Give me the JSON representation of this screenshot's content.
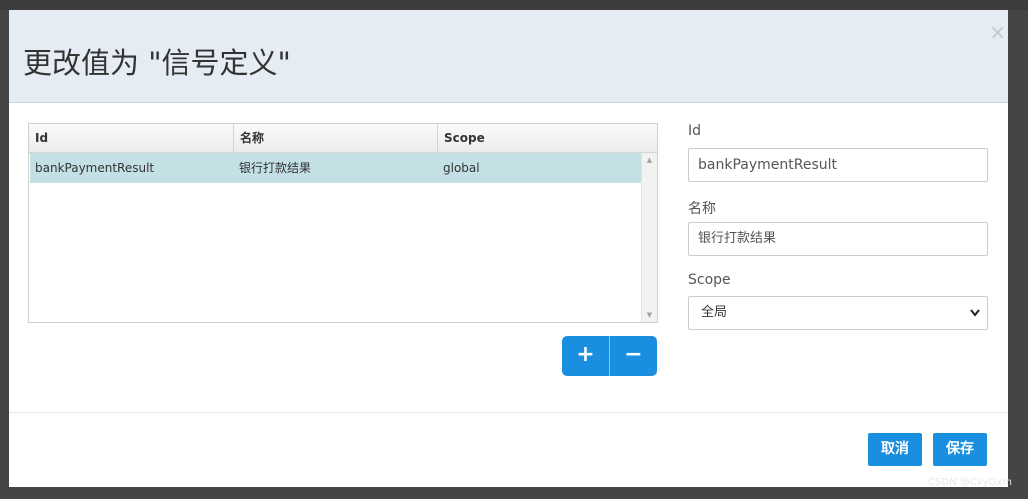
{
  "modal": {
    "title": "更改值为 \"信号定义\"",
    "close": "×"
  },
  "grid": {
    "columns": [
      "Id",
      "名称",
      "Scope"
    ],
    "rows": [
      {
        "id": "bankPaymentResult",
        "name": "银行打款结果",
        "scope": "global"
      }
    ],
    "scroll_up": "▲",
    "scroll_down": "▼"
  },
  "actions": {
    "add": "+",
    "remove": "−"
  },
  "form": {
    "id_label": "Id",
    "id_value": "bankPaymentResult",
    "name_label": "名称",
    "name_value": "银行打款结果",
    "scope_label": "Scope",
    "scope_value": "全局",
    "scope_chevron": "⌄"
  },
  "footer": {
    "cancel": "取消",
    "save": "保存"
  },
  "watermark": "CSDN @CxyGxm",
  "colors": {
    "accent": "#1a8fe0",
    "header_bg": "#e5ecf3",
    "selected_row": "#c3e0e5"
  }
}
